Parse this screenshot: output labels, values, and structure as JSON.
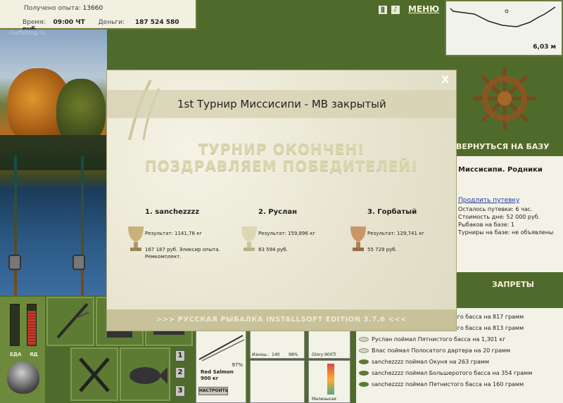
{
  "info": {
    "exp_label": "Получено опыта:",
    "exp_value": "13660",
    "time_label": "Время:",
    "time_value": "09:00 ЧТ",
    "money_label": "Деньги:",
    "money_value": "187 524 580 руб."
  },
  "topbar": {
    "pause_icon": "pause-icon",
    "sound_icon": "sound-icon",
    "menu_label": "МЕНЮ"
  },
  "scene": {
    "watermark": "rusfishing.ru"
  },
  "map": {
    "depth": "6,03 м"
  },
  "right": {
    "return_label": "ВЕРНУТЬСЯ НА БАЗУ",
    "base_title": "Миссисипи. Родники",
    "extend_link": "Продлить путевку",
    "lines": [
      "Осталось путевки: 6 час.",
      "Стоимость дня: 52 000 руб.",
      "Рыбаков на базе: 1",
      "Турниры на базе: не объявлены"
    ],
    "bans_label": "ЗАПРЕТЫ"
  },
  "chat": [
    "sanchezzzz поймал Пятнистого басса на 817 грамм",
    "sanchezzzz поймал Пятнистого басса на 813 грамм",
    "Руслан поймал Пятнистого басса на 1,301 кг",
    "Влас поймал Полосатого дартера на 20 грамм",
    "sanchezzzz поймал Окуня на 263 грамм",
    "sanchezzzz поймал Большеротого басса на 354 грамм",
    "sanchezzzz поймал Пятнистого басса на 160 грамм"
  ],
  "gauges": {
    "food_label": "ЕДА",
    "poison_label": "ЯД",
    "food_level": 0.0,
    "poison_level": 0.85
  },
  "slots": {
    "rod_pct": "97%",
    "rod_name": "Red Salmon",
    "rod_weight": "900 кг",
    "tune_label": "НАСТРОИТЬ",
    "reel_wear_label": "Изнош.:",
    "reel_wear_value": "140",
    "reel_pct": "98%",
    "line_name": "Glory-900Ti",
    "lure_name": "Маленькая"
  },
  "numbers": [
    "1",
    "2",
    "3"
  ],
  "dialog": {
    "title": "1st Турнир Миссисипи - MB закрытый",
    "banner1": "ТУРНИР ОКОНЧЕН!",
    "banner2": "ПОЗДРАВЛЯЕМ ПОБЕДИТЕЛЕЙ!",
    "close": "X",
    "winners": [
      {
        "place": "1. sanchezzzz",
        "result": "Результат: 1141,78 кг",
        "prize": "167 187 руб. Эликсир опыта. Ремкомплект."
      },
      {
        "place": "2. Руслан",
        "result": "Результат: 159,896 кг",
        "prize": "83 594 руб."
      },
      {
        "place": "3. Горбатый",
        "result": "Результат: 129,741 кг",
        "prize": "55 729 руб."
      }
    ],
    "footer": ">>> РУССКАЯ РЫБАЛКА INSTALLSOFT EDITION 3.7.6 <<<"
  }
}
